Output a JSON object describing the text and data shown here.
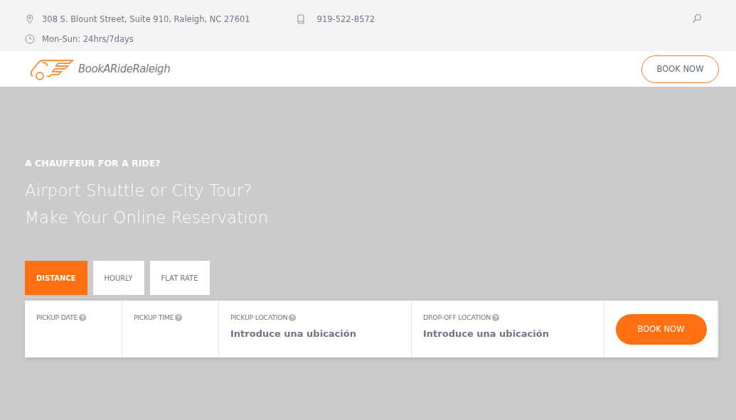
{
  "topbar": {
    "address": "308 S. Blount Street, Suite 910, Raleigh, NC 27601",
    "phone": "919-522-8572",
    "hours": "Mon-Sun: 24hrs/7days"
  },
  "header": {
    "logo_text": "BookARideRaleigh",
    "button": "BOOK NOW"
  },
  "hero": {
    "eyebrow": "A CHAUFFEUR FOR A RIDE?",
    "headline_lines": [
      "Airport Shuttle or City Tour?",
      "Make Your Online Reservation"
    ]
  },
  "tabs": [
    {
      "label": "DISTANCE",
      "selected": true
    },
    {
      "label": "HOURLY",
      "selected": false
    },
    {
      "label": "FLAT RATE",
      "selected": false
    }
  ],
  "form": {
    "fields": [
      {
        "label": "PICKUP DATE"
      },
      {
        "label": "PICKUP TIME"
      },
      {
        "label": "PICKUP LOCATION",
        "placeholder": "Introduce una ubicación"
      },
      {
        "label": "DROP-OFF LOCATION",
        "placeholder": "Introduce una ubicación"
      }
    ],
    "button": "BOOK NOW"
  }
}
